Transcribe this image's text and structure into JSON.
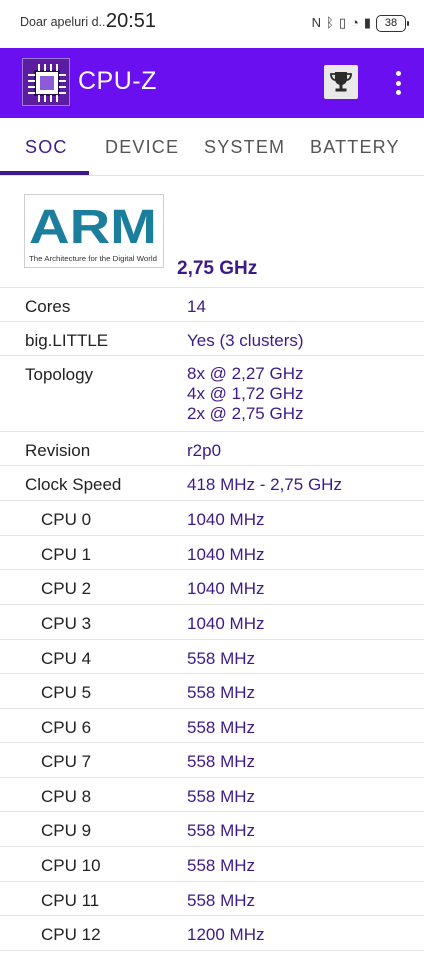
{
  "status_bar": {
    "carrier": "Doar apeluri d...",
    "time": "20:51",
    "battery": "38"
  },
  "app_bar": {
    "title": "CPU-Z",
    "accent_color": "#6a0ff0"
  },
  "tabs": [
    {
      "label": "SOC"
    },
    {
      "label": "DEVICE"
    },
    {
      "label": "SYSTEM"
    },
    {
      "label": "BATTERY"
    }
  ],
  "soc": {
    "vendor_logo_text": "ARM",
    "vendor_logo_tagline": "The Architecture for the Digital World",
    "max_frequency": "2,75 GHz",
    "rows": [
      {
        "label": "Cores",
        "value": "14"
      },
      {
        "label": "big.LITTLE",
        "value": "Yes (3 clusters)"
      },
      {
        "label": "Topology",
        "value_lines": [
          "8x  @ 2,27 GHz",
          "4x  @ 1,72 GHz",
          "2x  @ 2,75 GHz"
        ]
      },
      {
        "label": "Revision",
        "value": "r2p0"
      },
      {
        "label": "Clock Speed",
        "value": "418 MHz - 2,75 GHz"
      },
      {
        "label": "CPU 0",
        "value": "1040 MHz"
      },
      {
        "label": "CPU 1",
        "value": "1040 MHz"
      },
      {
        "label": "CPU 2",
        "value": "1040 MHz"
      },
      {
        "label": "CPU 3",
        "value": "1040 MHz"
      },
      {
        "label": "CPU 4",
        "value": "558 MHz"
      },
      {
        "label": "CPU 5",
        "value": "558 MHz"
      },
      {
        "label": "CPU 6",
        "value": "558 MHz"
      },
      {
        "label": "CPU 7",
        "value": "558 MHz"
      },
      {
        "label": "CPU 8",
        "value": "558 MHz"
      },
      {
        "label": "CPU 9",
        "value": "558 MHz"
      },
      {
        "label": "CPU 10",
        "value": "558 MHz"
      },
      {
        "label": "CPU 11",
        "value": "558 MHz"
      },
      {
        "label": "CPU 12",
        "value": "1200 MHz"
      }
    ]
  }
}
